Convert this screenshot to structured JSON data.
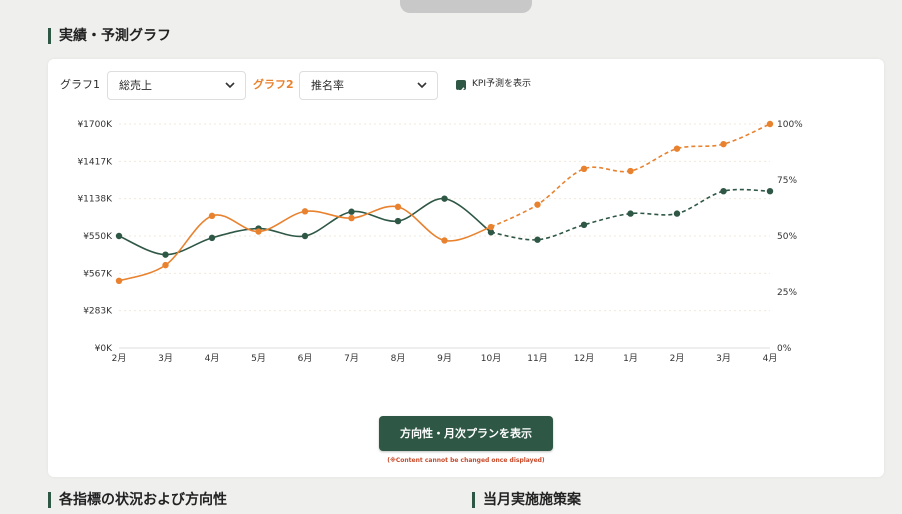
{
  "sections": {
    "graph_title": "実績・予測グラフ",
    "status_title": "各指標の状況および方向性",
    "measures_title": "当月実施施策案"
  },
  "controls": {
    "graph1_label": "グラフ1",
    "graph1_value": "総売上",
    "graph2_label": "グラフ2",
    "graph2_value": "推名率",
    "kpi_label": "KPI予測を表示",
    "kpi_checked": true
  },
  "button": {
    "label": "方向性・月次プランを表示",
    "note": "(※Content cannot be changed once displayed)"
  },
  "colors": {
    "accent_green": "#2f5746",
    "series1": "#2f5746",
    "series2": "#e8822f",
    "graph2_label": "#e8822f"
  },
  "chart_data": {
    "type": "line",
    "categories": [
      "2月",
      "3月",
      "4月",
      "5月",
      "6月",
      "7月",
      "8月",
      "9月",
      "10月",
      "11月",
      "12月",
      "1月",
      "2月",
      "3月",
      "4月"
    ],
    "y_left_ticks": [
      "¥1700K",
      "¥1417K",
      "¥1138K",
      "¥550K",
      "¥567K",
      "¥283K",
      "¥0K"
    ],
    "y_right_ticks": [
      "100%",
      "75%",
      "50%",
      "25%",
      "0%"
    ],
    "ylim_left_index": [
      0,
      6
    ],
    "ylim_right": [
      0,
      100
    ],
    "grid": true,
    "actual_until_index": 8,
    "series": [
      {
        "axis": "left",
        "color": "#2f5746",
        "values_level": [
          3.0,
          2.5,
          2.95,
          3.2,
          3.0,
          3.65,
          3.4,
          4.0,
          3.1,
          2.9,
          3.3,
          3.6,
          3.6,
          4.2,
          4.2
        ]
      },
      {
        "axis": "right",
        "color": "#e8822f",
        "values": [
          30,
          37,
          59,
          52,
          61,
          58,
          63,
          48,
          54,
          64,
          80,
          79,
          89,
          91,
          100
        ]
      }
    ]
  }
}
